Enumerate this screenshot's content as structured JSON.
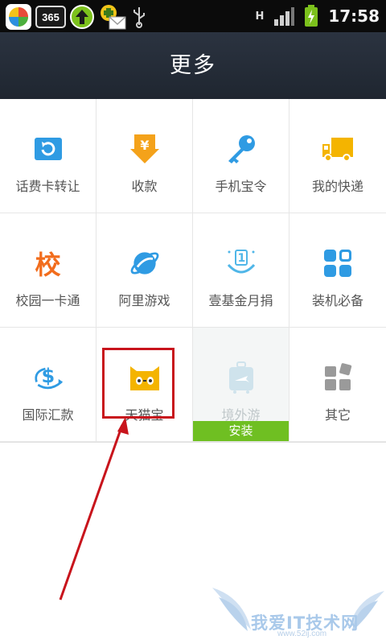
{
  "status_bar": {
    "app_badge": "365",
    "network": "H",
    "time": "17:58"
  },
  "header": {
    "title": "更多"
  },
  "grid": {
    "items": [
      {
        "label": "话费卡转让",
        "icon": "card-transfer-icon",
        "color": "#2f9be3"
      },
      {
        "label": "收款",
        "icon": "receive-money-icon",
        "color": "#f4a21a"
      },
      {
        "label": "手机宝令",
        "icon": "key-icon",
        "color": "#2f9be3"
      },
      {
        "label": "我的快递",
        "icon": "delivery-truck-icon",
        "color": "#f4b400"
      },
      {
        "label": "校园一卡通",
        "icon": "campus-icon",
        "icon_text": "校",
        "color": "#f26d1d"
      },
      {
        "label": "阿里游戏",
        "icon": "game-planet-icon",
        "color": "#2f9be3"
      },
      {
        "label": "壹基金月捐",
        "icon": "donation-icon",
        "icon_text": "1",
        "color": "#4fb6e8"
      },
      {
        "label": "装机必备",
        "icon": "apps-essential-icon",
        "color": "#2f9be3"
      },
      {
        "label": "国际汇款",
        "icon": "international-remit-icon",
        "icon_text": "$",
        "color": "#2f9be3"
      },
      {
        "label": "天猫宝",
        "icon": "tmall-cat-icon",
        "color": "#f4b400"
      },
      {
        "label": "境外游",
        "icon": "suitcase-icon",
        "color": "#cfe3ec",
        "install_label": "安装"
      },
      {
        "label": "其它",
        "icon": "more-grid-icon",
        "color": "#9a9a9a"
      }
    ]
  },
  "watermark": {
    "text": "我爱IT技术网",
    "sub": "www.52ij.com"
  }
}
